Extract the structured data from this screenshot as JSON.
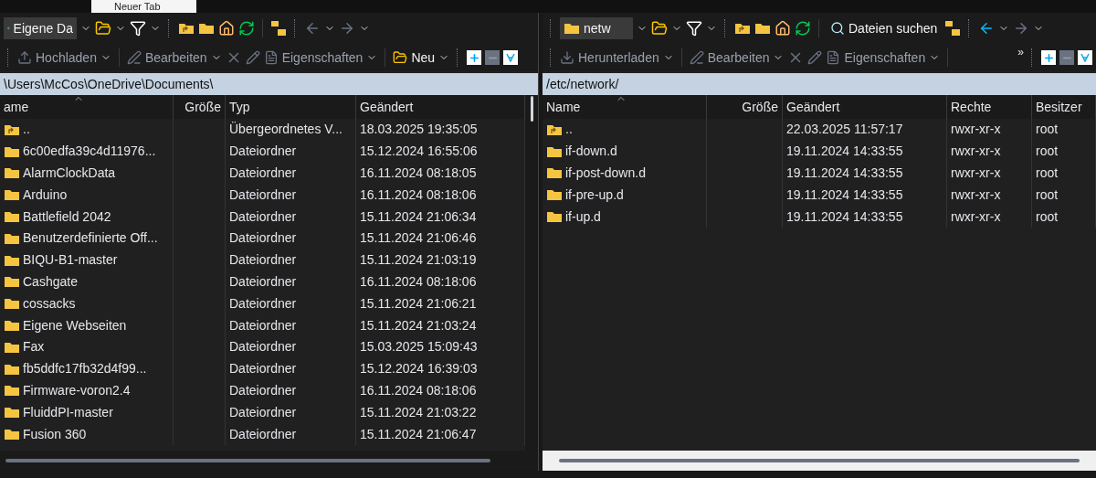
{
  "top_tab": {
    "label": "Neuer Tab"
  },
  "left_panel": {
    "location": "Eigene Da",
    "toolbar": [
      {
        "label": "Hochladen",
        "kind": "upload"
      },
      {
        "label": "Bearbeiten",
        "kind": "edit"
      },
      {
        "label": "Eigenschaften",
        "kind": "properties"
      },
      {
        "label": "Neu",
        "kind": "new"
      }
    ],
    "path": "\\Users\\McCos\\OneDrive\\Documents\\",
    "columns": [
      "ame",
      "Größe",
      "Typ",
      "Geändert"
    ],
    "rows": [
      {
        "kind": "parent",
        "cells": [
          "..",
          "",
          "Übergeordnetes V...",
          "18.03.2025 19:35:05"
        ]
      },
      {
        "kind": "folder",
        "cells": [
          "6c00edfa39c4d11976...",
          "",
          "Dateiordner",
          "15.12.2024 16:55:06"
        ]
      },
      {
        "kind": "folder",
        "cells": [
          "AlarmClockData",
          "",
          "Dateiordner",
          "16.11.2024 08:18:05"
        ]
      },
      {
        "kind": "folder",
        "cells": [
          "Arduino",
          "",
          "Dateiordner",
          "16.11.2024 08:18:06"
        ]
      },
      {
        "kind": "folder",
        "cells": [
          "Battlefield 2042",
          "",
          "Dateiordner",
          "15.11.2024 21:06:34"
        ]
      },
      {
        "kind": "folder",
        "cells": [
          "Benutzerdefinierte Off...",
          "",
          "Dateiordner",
          "15.11.2024 21:06:46"
        ]
      },
      {
        "kind": "folder",
        "cells": [
          "BIQU-B1-master",
          "",
          "Dateiordner",
          "15.11.2024 21:03:19"
        ]
      },
      {
        "kind": "folder",
        "cells": [
          "Cashgate",
          "",
          "Dateiordner",
          "16.11.2024 08:18:06"
        ]
      },
      {
        "kind": "folder",
        "cells": [
          "cossacks",
          "",
          "Dateiordner",
          "15.11.2024 21:06:21"
        ]
      },
      {
        "kind": "folder",
        "cells": [
          "Eigene Webseiten",
          "",
          "Dateiordner",
          "15.11.2024 21:03:24"
        ]
      },
      {
        "kind": "folder",
        "cells": [
          "Fax",
          "",
          "Dateiordner",
          "15.03.2025 15:09:43"
        ]
      },
      {
        "kind": "folder",
        "cells": [
          "fb5ddfc17fb32d4f99...",
          "",
          "Dateiordner",
          "15.12.2024 16:39:03"
        ]
      },
      {
        "kind": "folder",
        "cells": [
          "Firmware-voron2.4",
          "",
          "Dateiordner",
          "16.11.2024 08:18:06"
        ]
      },
      {
        "kind": "folder",
        "cells": [
          "FluiddPI-master",
          "",
          "Dateiordner",
          "15.11.2024 21:03:22"
        ]
      },
      {
        "kind": "folder",
        "cells": [
          "Fusion 360",
          "",
          "Dateiordner",
          "15.11.2024 21:06:47"
        ]
      }
    ]
  },
  "right_panel": {
    "location": "netw",
    "search_button": "Dateien suchen",
    "toolbar": [
      {
        "label": "Herunterladen",
        "kind": "download"
      },
      {
        "label": "Bearbeiten",
        "kind": "edit"
      },
      {
        "label": "Eigenschaften",
        "kind": "properties"
      },
      {
        "label": "»",
        "kind": "more"
      }
    ],
    "path": "/etc/network/",
    "columns": [
      "Name",
      "Größe",
      "Geändert",
      "Rechte",
      "Besitzer"
    ],
    "rows": [
      {
        "kind": "parent",
        "cells": [
          "..",
          "",
          "22.03.2025 11:57:17",
          "rwxr-xr-x",
          "root"
        ]
      },
      {
        "kind": "folder",
        "cells": [
          "if-down.d",
          "",
          "19.11.2024 14:33:55",
          "rwxr-xr-x",
          "root"
        ]
      },
      {
        "kind": "folder",
        "cells": [
          "if-post-down.d",
          "",
          "19.11.2024 14:33:55",
          "rwxr-xr-x",
          "root"
        ]
      },
      {
        "kind": "folder",
        "cells": [
          "if-pre-up.d",
          "",
          "19.11.2024 14:33:55",
          "rwxr-xr-x",
          "root"
        ]
      },
      {
        "kind": "folder",
        "cells": [
          "if-up.d",
          "",
          "19.11.2024 14:33:55",
          "rwxr-xr-x",
          "root"
        ]
      }
    ]
  }
}
